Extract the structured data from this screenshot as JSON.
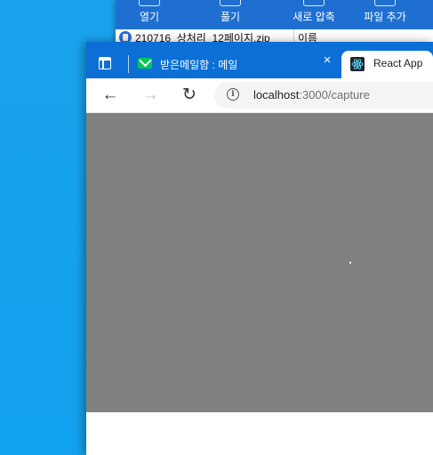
{
  "archive": {
    "toolbar": [
      {
        "label": "열기"
      },
      {
        "label": "풀기"
      },
      {
        "label": "새로 압축"
      },
      {
        "label": "파일 추가"
      }
    ],
    "file_name": "210716_상처리_12페이지.zip",
    "column_header": "이름"
  },
  "browser": {
    "tabs": [
      {
        "title": "받은메일함 : 메일",
        "favicon": "naver-mail-icon",
        "active": false
      },
      {
        "title": "React App",
        "favicon": "react-icon",
        "active": true
      }
    ],
    "close_symbol": "×",
    "nav": {
      "back": "←",
      "forward": "→",
      "reload": "↻"
    },
    "address": {
      "host": "localhost",
      "path": ":3000/capture",
      "info": "i"
    },
    "viewport_color": "#808080"
  }
}
